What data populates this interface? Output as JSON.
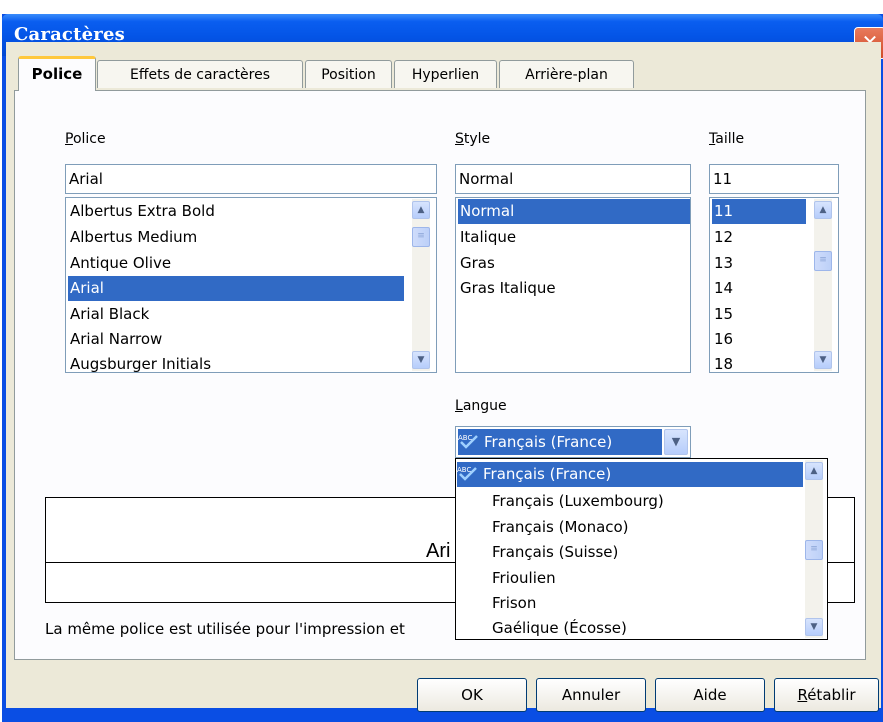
{
  "window": {
    "title": "Caractères",
    "close_glyph": "✕"
  },
  "tabs": [
    {
      "label": "Police",
      "active": true
    },
    {
      "label": "Effets de caractères"
    },
    {
      "label": "Position"
    },
    {
      "label": "Hyperlien"
    },
    {
      "label": "Arrière-plan"
    }
  ],
  "font": {
    "label": "Police",
    "value": "Arial",
    "options": [
      "Albertus Extra Bold",
      "Albertus Medium",
      "Antique Olive",
      "Arial",
      "Arial Black",
      "Arial Narrow",
      "Augsburger Initials"
    ],
    "selected": "Arial"
  },
  "style": {
    "label": "Style",
    "value": "Normal",
    "options": [
      "Normal",
      "Italique",
      "Gras",
      "Gras Italique"
    ],
    "selected": "Normal"
  },
  "size": {
    "label": "Taille",
    "value": "11",
    "options": [
      "11",
      "12",
      "13",
      "14",
      "15",
      "16",
      "18"
    ],
    "selected": "11"
  },
  "language": {
    "label": "Langue",
    "value": "Français (France)",
    "icon": "spellcheck-icon",
    "dropdown_options": [
      "Français (France)",
      "Français (Luxembourg)",
      "Français (Monaco)",
      "Français (Suisse)",
      "Frioulien",
      "Frison",
      "Gaélique (Écosse)"
    ],
    "selected": "Français (France)"
  },
  "preview": {
    "text": "Ari"
  },
  "info_text": "La même police est utilisée pour l'impression et",
  "buttons": {
    "ok": "OK",
    "cancel": "Annuler",
    "help": "Aide",
    "reset": "Rétablir"
  },
  "colors": {
    "titlebar": "#0454e6",
    "selection": "#316ac5",
    "active_tab_accent": "#ffc83c",
    "dialog_bg": "#ece9d8"
  }
}
